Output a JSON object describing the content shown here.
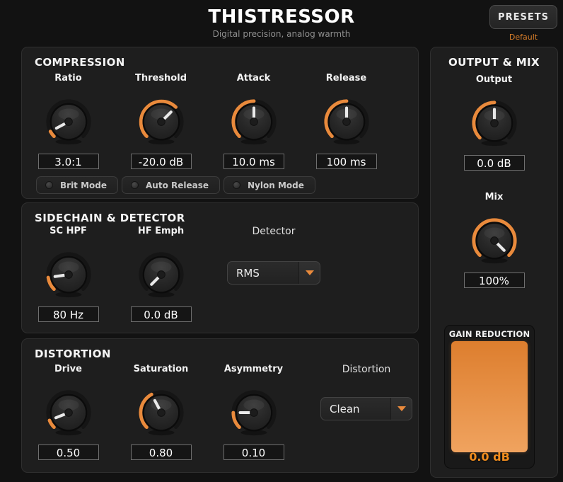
{
  "header": {
    "title": "THISTRESSOR",
    "subtitle": "Digital precision, analog warmth",
    "presets_label": "PRESETS",
    "preset_name": "Default"
  },
  "colors": {
    "accent": "#e98a3c",
    "meter_orange_top": "#dd7e2e",
    "meter_orange_bottom": "#f0a35f",
    "preset_name_orange": "#d87e2a"
  },
  "sections": {
    "compression": {
      "title": "COMPRESSION",
      "knobs": [
        {
          "label": "Ratio",
          "value": "3.0:1",
          "angle": -118
        },
        {
          "label": "Threshold",
          "value": "-20.0 dB",
          "angle": 45
        },
        {
          "label": "Attack",
          "value": "10.0 ms",
          "angle": 0
        },
        {
          "label": "Release",
          "value": "100 ms",
          "angle": 0
        }
      ],
      "toggles": [
        {
          "label": "Brit Mode",
          "active": false
        },
        {
          "label": "Auto Release",
          "active": false
        },
        {
          "label": "Nylon Mode",
          "active": false
        }
      ]
    },
    "sidechain": {
      "title": "SIDECHAIN & DETECTOR",
      "knobs": [
        {
          "label": "SC HPF",
          "value": "80 Hz",
          "angle": -98
        },
        {
          "label": "HF Emph",
          "value": "0.0 dB",
          "angle": -135
        }
      ],
      "detector": {
        "label": "Detector",
        "selected": "RMS"
      }
    },
    "distortion": {
      "title": "DISTORTION",
      "knobs": [
        {
          "label": "Drive",
          "value": "0.50",
          "angle": -112
        },
        {
          "label": "Saturation",
          "value": "0.80",
          "angle": -28
        },
        {
          "label": "Asymmetry",
          "value": "0.10",
          "angle": -90
        }
      ],
      "mode": {
        "label": "Distortion",
        "selected": "Clean"
      }
    },
    "output": {
      "title": "OUTPUT & MIX",
      "knobs": [
        {
          "label": "Output",
          "value": "0.0 dB",
          "angle": 0
        },
        {
          "label": "Mix",
          "value": "100%",
          "angle": 135
        }
      ],
      "meter": {
        "label": "GAIN REDUCTION",
        "value": "0.0 dB",
        "fill_percent": 100
      }
    }
  }
}
